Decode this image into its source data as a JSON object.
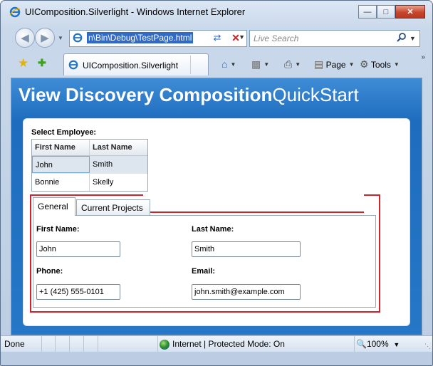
{
  "window": {
    "title": "UIComposition.Silverlight - Windows Internet Explorer",
    "controls": [
      "minimize-icon",
      "maximize-icon",
      "close-icon"
    ]
  },
  "addressbar": {
    "url": "n\\Bin\\Debug\\TestPage.html",
    "search_placeholder": "Live Search"
  },
  "tabs": {
    "active_tab": "UIComposition.Silverlight"
  },
  "toolbar": {
    "page_label": "Page",
    "tools_label": "Tools",
    "icons": [
      "home-icon",
      "feeds-icon",
      "print-icon",
      "page-icon",
      "tools-gear-icon"
    ]
  },
  "app": {
    "heading_bold": "View Discovery Composition",
    "heading_light": "QuickStart",
    "select_label": "Select Employee:",
    "grid": {
      "columns": [
        "First Name",
        "Last Name"
      ],
      "rows": [
        {
          "first": "John",
          "last": "Smith"
        },
        {
          "first": "Bonnie",
          "last": "Skelly"
        }
      ],
      "selected_index": 0
    },
    "detail_tabs": [
      "General",
      "Current Projects"
    ],
    "active_detail_tab": "General",
    "form": {
      "first_name_label": "First Name:",
      "first_name_value": "John",
      "last_name_label": "Last Name:",
      "last_name_value": "Smith",
      "phone_label": "Phone:",
      "phone_value": "+1 (425) 555-0101",
      "email_label": "Email:",
      "email_value": "john.smith@example.com"
    },
    "highlight_color": "#d4212b"
  },
  "statusbar": {
    "status": "Done",
    "zone": "Internet | Protected Mode: On",
    "zoom": "100%"
  }
}
